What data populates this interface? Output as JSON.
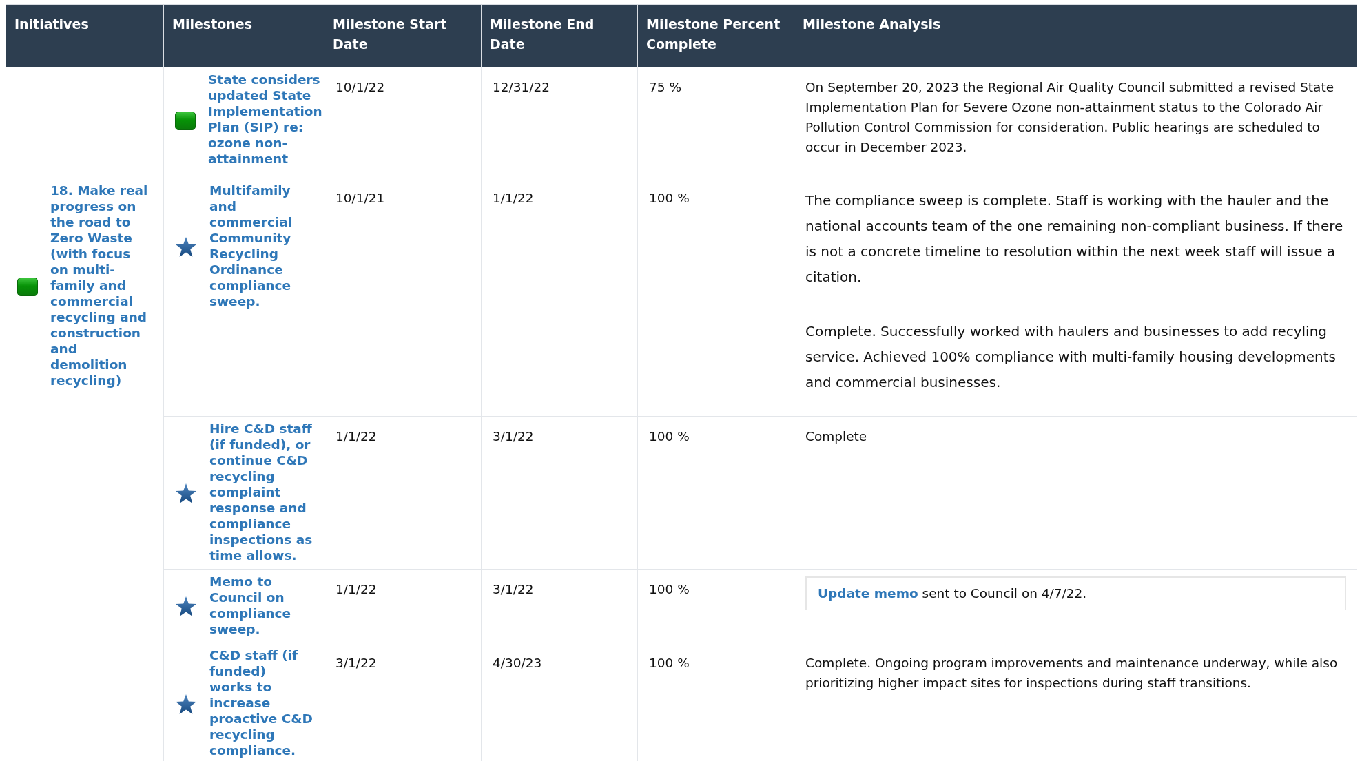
{
  "table": {
    "columns": [
      "Initiatives",
      "Milestones",
      "Milestone Start Date",
      "Milestone End Date",
      "Milestone Percent Complete",
      "Milestone Analysis"
    ],
    "groups": [
      {
        "milestones": [
          {
            "kind": "square",
            "title": "State considers updated State Implementation Plan (SIP) re: ozone non-attainment",
            "start": "10/1/22",
            "end": "12/31/22",
            "percent": "75 %",
            "analysis": [
              {
                "kind": "text",
                "text": "On September 20, 2023 the Regional Air Quality Council submitted a revised State Implementation Plan for Severe Ozone non-attainment status to the Colorado Air Pollution Control Commission for consideration. Public hearings are scheduled to occur in December 2023."
              }
            ]
          }
        ]
      },
      {
        "initiative": {
          "kind": "square",
          "title": "18. Make real progress on the road to Zero Waste (with focus on multi-family and commercial recycling and construction and demolition recycling)"
        },
        "milestones": [
          {
            "kind": "star",
            "title": "Multifamily and commercial Community Recycling Ordinance compliance sweep.",
            "start": "10/1/21",
            "end": "1/1/22",
            "percent": "100 %",
            "analysis": [
              {
                "kind": "large",
                "text": "The compliance sweep is complete. Staff is working with the hauler and the national accounts team of the one remaining non-compliant business. If there is not a concrete timeline to resolution within the next week staff will issue a citation."
              },
              {
                "kind": "large",
                "text": "Complete. Successfully worked with haulers and businesses to add recyling service. Achieved 100% compliance with multi-family housing developments and commercial businesses."
              }
            ]
          },
          {
            "kind": "star",
            "title": "Hire C&D staff (if funded), or continue C&D recycling complaint response and compliance inspections as time allows.",
            "start": "1/1/22",
            "end": "3/1/22",
            "percent": "100 %",
            "analysis": [
              {
                "kind": "text",
                "text": "Complete"
              }
            ]
          },
          {
            "kind": "star",
            "title": "Memo to Council on compliance sweep.",
            "start": "1/1/22",
            "end": "3/1/22",
            "percent": "100 %",
            "analysis": [
              {
                "kind": "boxed",
                "link": "Update memo",
                "text": "sent to Council on 4/7/22."
              }
            ]
          },
          {
            "kind": "star",
            "title": "C&D staff (if funded) works to increase proactive C&D recycling compliance.",
            "start": "3/1/22",
            "end": "4/30/23",
            "percent": "100 %",
            "analysis": [
              {
                "kind": "text",
                "text": "Complete. Ongoing program improvements and maintenance underway, while also prioritizing higher impact sites for inspections during staff transitions."
              }
            ]
          }
        ]
      }
    ]
  }
}
